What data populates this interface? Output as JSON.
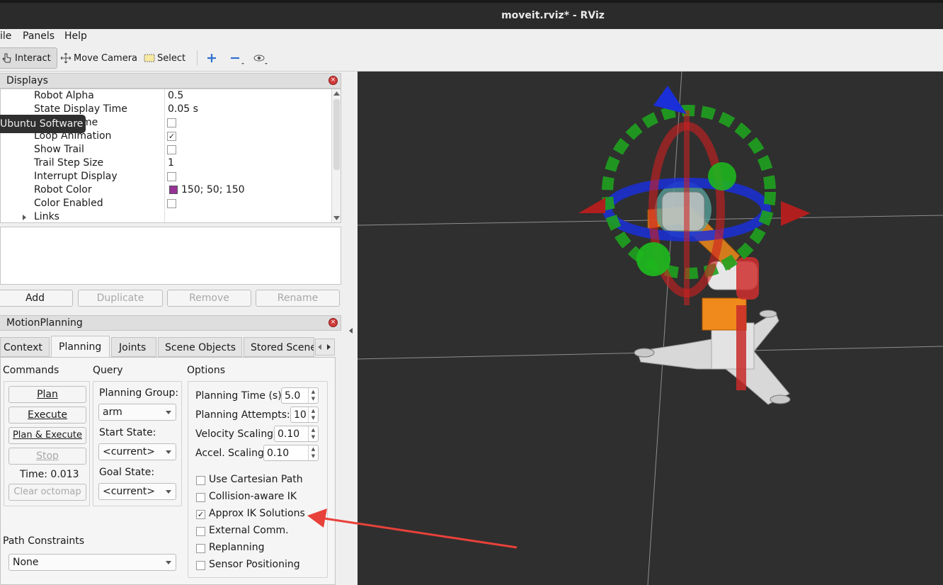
{
  "window": {
    "title": "moveit.rviz* - RViz"
  },
  "menu": {
    "file": "ile",
    "panels": "Panels",
    "help": "Help"
  },
  "toolbar": {
    "interact": "Interact",
    "move_camera": "Move Camera",
    "select": "Select"
  },
  "displays": {
    "title": "Displays",
    "close": "×",
    "rows": [
      {
        "key": "Robot Alpha",
        "value": "0.5"
      },
      {
        "key": "State Display Time",
        "value": "0.05 s"
      },
      {
        "key": "me",
        "value": ""
      },
      {
        "key": "Loop Animation",
        "value": ""
      },
      {
        "key": "Show Trail",
        "value": ""
      },
      {
        "key": "Trail Step Size",
        "value": "1"
      },
      {
        "key": "Interrupt Display",
        "value": ""
      },
      {
        "key": "Robot Color",
        "value": "150; 50; 150"
      },
      {
        "key": "Color Enabled",
        "value": ""
      },
      {
        "key": "Links",
        "value": ""
      }
    ],
    "robot_color_swatch": "#963296",
    "check": "✓",
    "tooltip": "Ubuntu Software",
    "buttons": {
      "add": "Add",
      "duplicate": "Duplicate",
      "remove": "Remove",
      "rename": "Rename"
    }
  },
  "motion_planning": {
    "title": "MotionPlanning",
    "close": "×",
    "tabs": [
      "Context",
      "Planning",
      "Joints",
      "Scene Objects",
      "Stored Scene"
    ],
    "commands": {
      "label": "Commands",
      "plan": "Plan",
      "execute": "Execute",
      "plan_execute": "Plan & Execute",
      "stop": "Stop",
      "time": "Time: 0.013",
      "clear_octomap": "Clear octomap"
    },
    "query": {
      "label": "Query",
      "planning_group_label": "Planning Group:",
      "planning_group": "arm",
      "start_state_label": "Start State:",
      "start_state": "<current>",
      "goal_state_label": "Goal State:",
      "goal_state": "<current>"
    },
    "options": {
      "label": "Options",
      "planning_time_label": "Planning Time (s):",
      "planning_time": "5.0",
      "planning_attempts_label": "Planning Attempts:",
      "planning_attempts": "10",
      "velocity_scaling_label": "Velocity Scaling:",
      "velocity_scaling": "0.10",
      "accel_scaling_label": "Accel. Scaling:",
      "accel_scaling": "0.10",
      "checkboxes": [
        {
          "label": "Use Cartesian Path",
          "checked": false
        },
        {
          "label": "Collision-aware IK",
          "checked": false
        },
        {
          "label": "Approx IK Solutions",
          "checked": true
        },
        {
          "label": "External Comm.",
          "checked": false
        },
        {
          "label": "Replanning",
          "checked": false
        },
        {
          "label": "Sensor Positioning",
          "checked": false
        }
      ]
    },
    "path_constraints": {
      "label": "Path Constraints",
      "value": "None"
    }
  },
  "colors": {
    "annotation_arrow": "#e8413a",
    "viewport_bg": "#2f2f2f"
  }
}
